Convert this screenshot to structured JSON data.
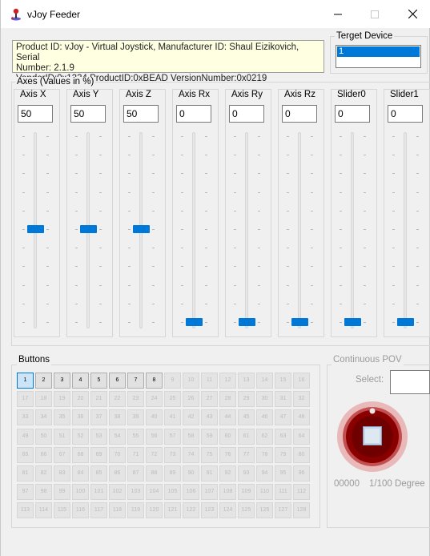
{
  "window": {
    "title": "vJoy Feeder",
    "accent_color": "#0078d7"
  },
  "info": {
    "line1": "Product ID: vJoy - Virtual Joystick, Manufacturer ID: Shaul Eizikovich, Serial",
    "line2": "Number: 2.1.9",
    "line3": "VendorID:0x1234 ProductID:0xBEAD VersionNumber:0x0219"
  },
  "target_device": {
    "title": "Terget Device",
    "selected": "1"
  },
  "axes": {
    "title": "Axes (Values in %)",
    "items": [
      {
        "label": "Axis X",
        "value": "50",
        "level": 0.5
      },
      {
        "label": "Axis Y",
        "value": "50",
        "level": 0.5
      },
      {
        "label": "Axis Z",
        "value": "50",
        "level": 0.5
      },
      {
        "label": "Axis Rx",
        "value": "0",
        "level": 0
      },
      {
        "label": "Axis Ry",
        "value": "0",
        "level": 0
      },
      {
        "label": "Axis Rz",
        "value": "0",
        "level": 0
      },
      {
        "label": "Slider0",
        "value": "0",
        "level": 0
      },
      {
        "label": "Slider1",
        "value": "0",
        "level": 0
      }
    ]
  },
  "buttons": {
    "title": "Buttons",
    "count": 128,
    "enabled_count": 8,
    "selected": 1
  },
  "pov": {
    "title": "Continuous POV",
    "select_label": "Select:",
    "value": "00000",
    "unit": "1/100 Degree"
  }
}
